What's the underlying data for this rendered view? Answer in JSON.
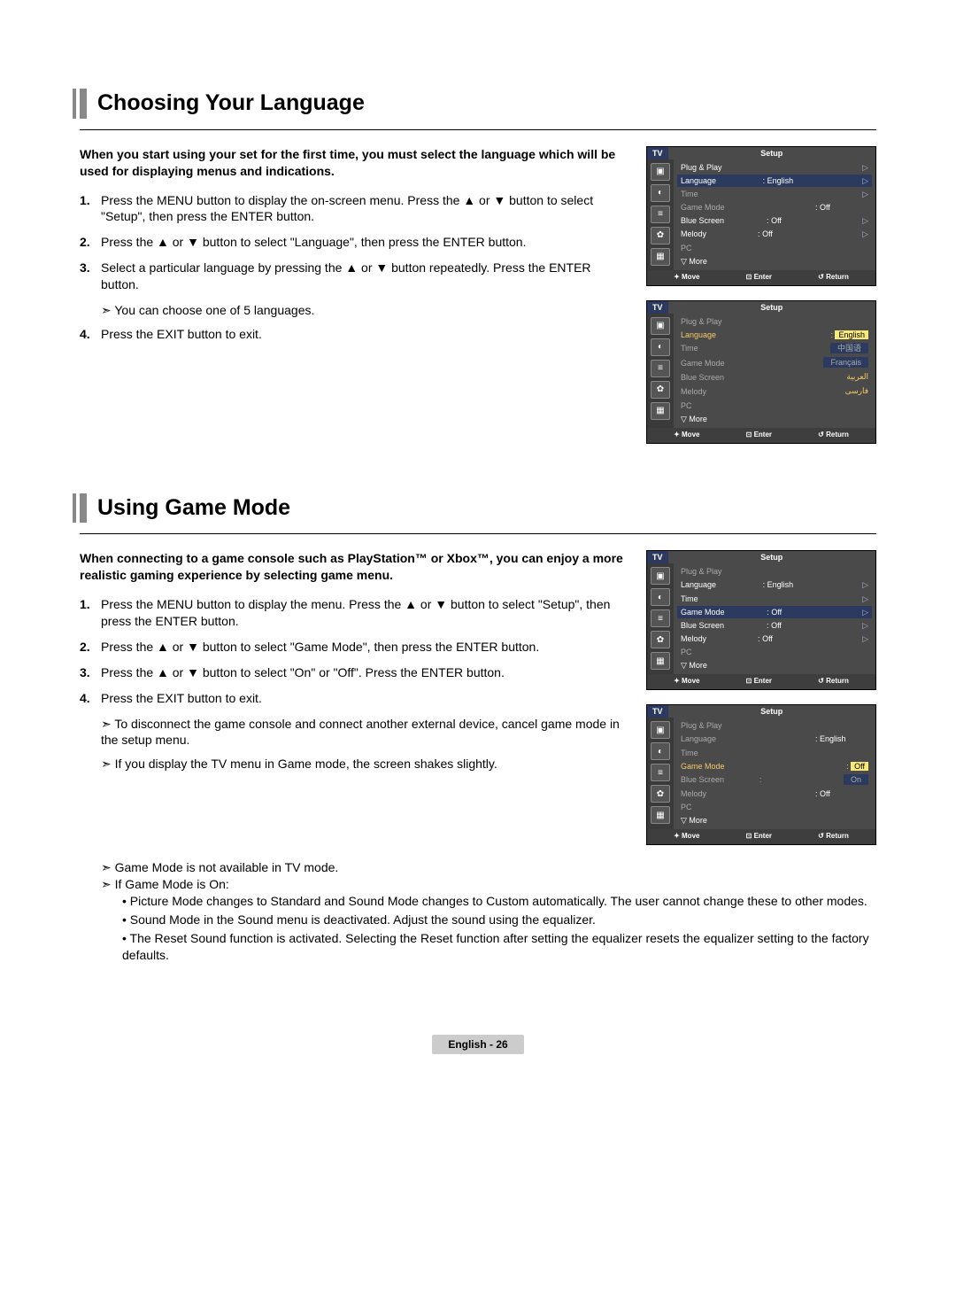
{
  "section1": {
    "title": "Choosing Your Language",
    "intro": "When you start using your set for the first time, you must select the language which will be used for displaying menus and indications.",
    "steps": [
      "Press the MENU button to display the on-screen menu. Press the ▲ or ▼ button to select \"Setup\", then press the ENTER button.",
      "Press the ▲ or ▼ button to select \"Language\", then press the ENTER button.",
      "Select a particular language by pressing the ▲ or ▼ button repeatedly. Press the ENTER button.",
      "Press the EXIT button to exit."
    ],
    "step3_note": "You can choose one of 5 languages."
  },
  "section2": {
    "title": "Using Game Mode",
    "intro": "When connecting to a game console such as PlayStation™ or Xbox™, you can enjoy a more realistic gaming experience by selecting game menu.",
    "steps": [
      "Press the MENU button to display the menu. Press the ▲ or ▼ button to select \"Setup\", then press the ENTER button.",
      "Press the ▲ or ▼ button to select \"Game Mode\", then press the ENTER button.",
      "Press the ▲ or ▼ button to select \"On\" or \"Off\". Press the ENTER button.",
      "Press the EXIT button to exit."
    ],
    "notes": [
      "To disconnect the game console and connect another external device, cancel game mode in the setup menu.",
      "If you display the TV menu in Game mode, the screen shakes slightly.",
      "Game Mode is not available in TV mode.",
      "If Game Mode is On:"
    ],
    "bullets": [
      "Picture Mode changes to Standard and Sound Mode changes to Custom automatically. The user cannot change these to other modes.",
      "Sound Mode in the Sound menu is deactivated. Adjust the sound using the equalizer.",
      "The Reset Sound function is activated. Selecting the Reset function after setting the equalizer resets the equalizer setting to the factory defaults."
    ]
  },
  "osd": {
    "tv": "TV",
    "setup": "Setup",
    "more": "More",
    "foot_move": "Move",
    "foot_enter": "Enter",
    "foot_return": "Return",
    "items": {
      "plugplay": "Plug & Play",
      "language": "Language",
      "time": "Time",
      "gamemode": "Game Mode",
      "bluescreen": "Blue Screen",
      "melody": "Melody",
      "pc": "PC"
    },
    "vals": {
      "english": "English",
      "off": "Off",
      "on": "On"
    },
    "langopts": {
      "english": "English",
      "chinese": "中国语",
      "francais": "Français",
      "arabic": "العربية",
      "farsi": "فارسی"
    }
  },
  "footer": "English - 26"
}
